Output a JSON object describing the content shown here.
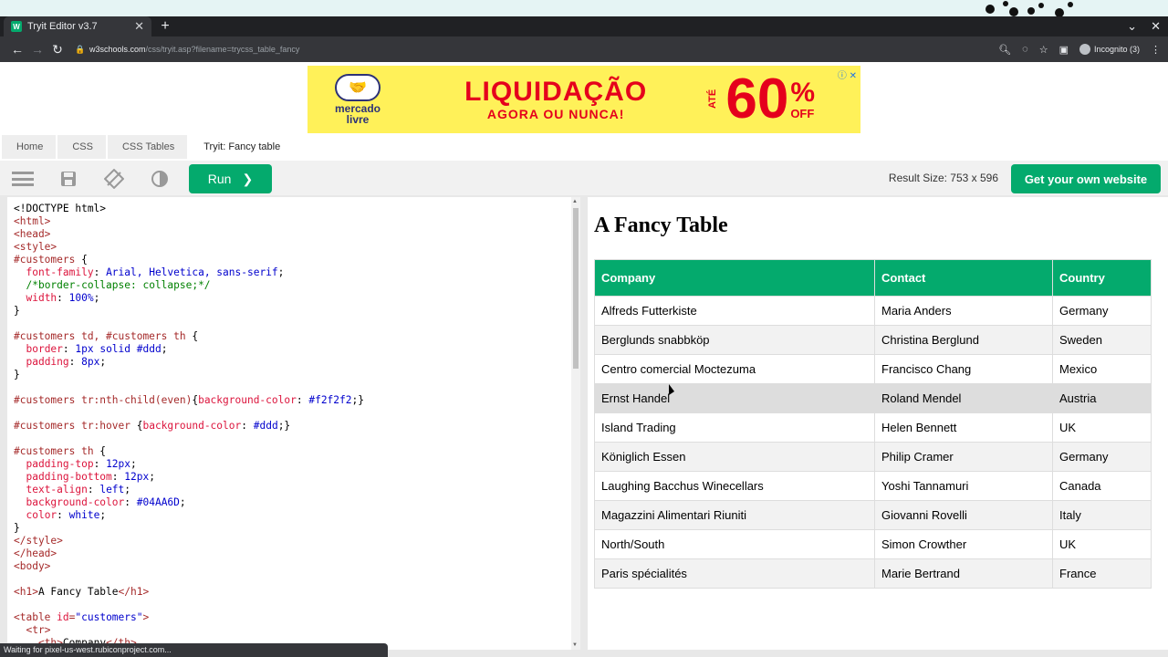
{
  "browser": {
    "tab_title": "Tryit Editor v3.7",
    "favicon_text": "W",
    "url_host": "w3schools.com",
    "url_path": "/css/tryit.asp?filename=trycss_table_fancy",
    "incognito_label": "Incognito (3)",
    "status_text": "Waiting for pixel-us-west.rubiconproject.com..."
  },
  "ad": {
    "brand_line1": "mercado",
    "brand_line2": "livre",
    "headline": "LIQUIDAÇÃO",
    "subline": "AGORA OU NUNCA!",
    "ate": "ATÉ",
    "percent_value": "60",
    "percent_sign": "%",
    "off": "OFF"
  },
  "breadcrumbs": [
    "Home",
    "CSS",
    "CSS Tables",
    "Tryit: Fancy table"
  ],
  "toolbar": {
    "run_label": "Run",
    "run_arrow": "❯",
    "result_size": "Result Size: 753 x 596",
    "get_own_label": "Get your own website"
  },
  "result": {
    "heading": "A Fancy Table",
    "headers": [
      "Company",
      "Contact",
      "Country"
    ],
    "rows": [
      [
        "Alfreds Futterkiste",
        "Maria Anders",
        "Germany"
      ],
      [
        "Berglunds snabbköp",
        "Christina Berglund",
        "Sweden"
      ],
      [
        "Centro comercial Moctezuma",
        "Francisco Chang",
        "Mexico"
      ],
      [
        "Ernst Handel",
        "Roland Mendel",
        "Austria"
      ],
      [
        "Island Trading",
        "Helen Bennett",
        "UK"
      ],
      [
        "Königlich Essen",
        "Philip Cramer",
        "Germany"
      ],
      [
        "Laughing Bacchus Winecellars",
        "Yoshi Tannamuri",
        "Canada"
      ],
      [
        "Magazzini Alimentari Riuniti",
        "Giovanni Rovelli",
        "Italy"
      ],
      [
        "North/South",
        "Simon Crowther",
        "UK"
      ],
      [
        "Paris spécialités",
        "Marie Bertrand",
        "France"
      ]
    ],
    "hovered_row_index": 3
  },
  "code_lines": [
    [
      [
        "txt",
        "<!DOCTYPE html>"
      ]
    ],
    [
      [
        "tag",
        "<html>"
      ]
    ],
    [
      [
        "tag",
        "<head>"
      ]
    ],
    [
      [
        "tag",
        "<style>"
      ]
    ],
    [
      [
        "sel",
        "#customers"
      ],
      [
        "txt",
        " {"
      ]
    ],
    [
      [
        "txt",
        "  "
      ],
      [
        "prop",
        "font-family"
      ],
      [
        "txt",
        ": "
      ],
      [
        "val",
        "Arial, Helvetica, sans-serif"
      ],
      [
        "txt",
        ";"
      ]
    ],
    [
      [
        "txt",
        "  "
      ],
      [
        "cmt",
        "/*border-collapse: collapse;*/"
      ]
    ],
    [
      [
        "txt",
        "  "
      ],
      [
        "prop",
        "width"
      ],
      [
        "txt",
        ": "
      ],
      [
        "val",
        "100%"
      ],
      [
        "txt",
        ";"
      ]
    ],
    [
      [
        "txt",
        "}"
      ]
    ],
    [
      [
        "txt",
        ""
      ]
    ],
    [
      [
        "sel",
        "#customers td, #customers th"
      ],
      [
        "txt",
        " {"
      ]
    ],
    [
      [
        "txt",
        "  "
      ],
      [
        "prop",
        "border"
      ],
      [
        "txt",
        ": "
      ],
      [
        "val",
        "1px solid #ddd"
      ],
      [
        "txt",
        ";"
      ]
    ],
    [
      [
        "txt",
        "  "
      ],
      [
        "prop",
        "padding"
      ],
      [
        "txt",
        ": "
      ],
      [
        "val",
        "8px"
      ],
      [
        "txt",
        ";"
      ]
    ],
    [
      [
        "txt",
        "}"
      ]
    ],
    [
      [
        "txt",
        ""
      ]
    ],
    [
      [
        "sel",
        "#customers tr:nth-child(even)"
      ],
      [
        "txt",
        "{"
      ],
      [
        "prop",
        "background-color"
      ],
      [
        "txt",
        ": "
      ],
      [
        "val",
        "#f2f2f2"
      ],
      [
        "txt",
        ";}"
      ]
    ],
    [
      [
        "txt",
        ""
      ]
    ],
    [
      [
        "sel",
        "#customers tr:hover"
      ],
      [
        "txt",
        " {"
      ],
      [
        "prop",
        "background-color"
      ],
      [
        "txt",
        ": "
      ],
      [
        "val",
        "#ddd"
      ],
      [
        "txt",
        ";}"
      ]
    ],
    [
      [
        "txt",
        ""
      ]
    ],
    [
      [
        "sel",
        "#customers th"
      ],
      [
        "txt",
        " {"
      ]
    ],
    [
      [
        "txt",
        "  "
      ],
      [
        "prop",
        "padding-top"
      ],
      [
        "txt",
        ": "
      ],
      [
        "val",
        "12px"
      ],
      [
        "txt",
        ";"
      ]
    ],
    [
      [
        "txt",
        "  "
      ],
      [
        "prop",
        "padding-bottom"
      ],
      [
        "txt",
        ": "
      ],
      [
        "val",
        "12px"
      ],
      [
        "txt",
        ";"
      ]
    ],
    [
      [
        "txt",
        "  "
      ],
      [
        "prop",
        "text-align"
      ],
      [
        "txt",
        ": "
      ],
      [
        "val",
        "left"
      ],
      [
        "txt",
        ";"
      ]
    ],
    [
      [
        "txt",
        "  "
      ],
      [
        "prop",
        "background-color"
      ],
      [
        "txt",
        ": "
      ],
      [
        "val",
        "#04AA6D"
      ],
      [
        "txt",
        ";"
      ]
    ],
    [
      [
        "txt",
        "  "
      ],
      [
        "prop",
        "color"
      ],
      [
        "txt",
        ": "
      ],
      [
        "val",
        "white"
      ],
      [
        "txt",
        ";"
      ]
    ],
    [
      [
        "txt",
        "}"
      ]
    ],
    [
      [
        "tag",
        "</style>"
      ]
    ],
    [
      [
        "tag",
        "</head>"
      ]
    ],
    [
      [
        "tag",
        "<body>"
      ]
    ],
    [
      [
        "txt",
        ""
      ]
    ],
    [
      [
        "tag",
        "<h1>"
      ],
      [
        "txt",
        "A Fancy Table"
      ],
      [
        "tag",
        "</h1>"
      ]
    ],
    [
      [
        "txt",
        ""
      ]
    ],
    [
      [
        "tag",
        "<table "
      ],
      [
        "attr",
        "id"
      ],
      [
        "tag",
        "="
      ],
      [
        "aval",
        "\"customers\""
      ],
      [
        "tag",
        ">"
      ]
    ],
    [
      [
        "txt",
        "  "
      ],
      [
        "tag",
        "<tr>"
      ]
    ],
    [
      [
        "txt",
        "    "
      ],
      [
        "tag",
        "<th>"
      ],
      [
        "txt",
        "Company"
      ],
      [
        "tag",
        "</th>"
      ]
    ]
  ],
  "colors": {
    "accent": "#04AA6D",
    "even_row": "#f2f2f2",
    "hover_row": "#ddd",
    "ad_yellow": "#fff159"
  }
}
